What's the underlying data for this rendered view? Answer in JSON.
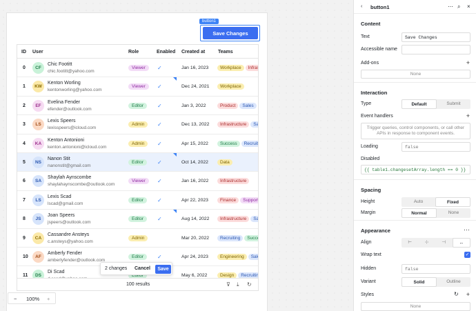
{
  "canvas": {
    "button_tag": "button1",
    "save_changes_label": "Save Changes",
    "table": {
      "headers": {
        "id": "ID",
        "user": "User",
        "role": "Role",
        "enabled": "Enabled",
        "created": "Created at",
        "teams": "Teams"
      },
      "rows": [
        {
          "id": "0",
          "initials": "CF",
          "name": "Chic Footitt",
          "email": "chic.footitt@yahoo.com",
          "role": "Viewer",
          "enabled": true,
          "edited": false,
          "date": "Jan 16, 2023",
          "teams": [
            "Workplace",
            "Infrastructure"
          ],
          "avatar_bg": "#c9f2d9",
          "avatar_fg": "#1f7a47"
        },
        {
          "id": "1",
          "initials": "KW",
          "name": "Kenton Worling",
          "email": "kentonworling@yahoo.com",
          "role": "Viewer",
          "enabled": true,
          "edited": true,
          "date": "Dec 24, 2021",
          "teams": [
            "Workplace"
          ],
          "avatar_bg": "#fbe9a8",
          "avatar_fg": "#8a6b00"
        },
        {
          "id": "2",
          "initials": "EF",
          "name": "Evelina Fender",
          "email": "efender@outlook.com",
          "role": "Editor",
          "enabled": true,
          "edited": false,
          "date": "Jan 3, 2022",
          "teams": [
            "Product",
            "Sales"
          ],
          "avatar_bg": "#f6dbf2",
          "avatar_fg": "#9b2f8c"
        },
        {
          "id": "3",
          "initials": "LS",
          "name": "Lexis Speers",
          "email": "lexisspeers@icloud.com",
          "role": "Admin",
          "enabled": true,
          "edited": false,
          "date": "Dec 13, 2022",
          "teams": [
            "Infrastructure",
            "Sales"
          ],
          "avatar_bg": "#fbd9c4",
          "avatar_fg": "#a04a14"
        },
        {
          "id": "4",
          "initials": "KA",
          "name": "Kenton Antonioni",
          "email": "kenton.antonioni@icloud.com",
          "role": "Admin",
          "enabled": true,
          "edited": false,
          "date": "Apr 15, 2022",
          "teams": [
            "Success",
            "Recruiting"
          ],
          "avatar_bg": "#f6dbf2",
          "avatar_fg": "#9b2f8c"
        },
        {
          "id": "5",
          "initials": "NS",
          "name": "Nanon Stit",
          "email": "nanonstit@gmail.com",
          "role": "Editor",
          "enabled": true,
          "edited": true,
          "date": "Oct 14, 2022",
          "teams": [
            "Data"
          ],
          "avatar_bg": "#d6e4fb",
          "avatar_fg": "#2a56b0",
          "selected": true
        },
        {
          "id": "6",
          "initials": "SA",
          "name": "Shaylah Aynscombe",
          "email": "shaylahaynscombe@outlook.com",
          "role": "Viewer",
          "enabled": true,
          "edited": false,
          "date": "Jan 16, 2022",
          "teams": [
            "Infrastructure"
          ],
          "avatar_bg": "#d6e4fb",
          "avatar_fg": "#2a56b0"
        },
        {
          "id": "7",
          "initials": "LS",
          "name": "Lexis Scad",
          "email": "lscad@gmail.com",
          "role": "Editor",
          "enabled": true,
          "edited": false,
          "date": "Apr 22, 2023",
          "teams": [
            "Finance",
            "Support"
          ],
          "avatar_bg": "#d6e4fb",
          "avatar_fg": "#2a56b0"
        },
        {
          "id": "8",
          "initials": "JS",
          "name": "Joan Speers",
          "email": "jspeers@outlook.com",
          "role": "Editor",
          "enabled": true,
          "edited": true,
          "date": "Aug 14, 2022",
          "teams": [
            "Infrastructure",
            "Sales"
          ],
          "avatar_bg": "#d6e4fb",
          "avatar_fg": "#2a56b0"
        },
        {
          "id": "9",
          "initials": "CA",
          "name": "Cassandre Ansteys",
          "email": "c.ansteys@yahoo.com",
          "role": "Admin",
          "enabled": false,
          "edited": false,
          "date": "Mar 20, 2022",
          "teams": [
            "Recruiting",
            "Success"
          ],
          "avatar_bg": "#fbe9a8",
          "avatar_fg": "#8a6b00"
        },
        {
          "id": "10",
          "initials": "AF",
          "name": "Amberly Fender",
          "email": "amberlyfender@outlook.com",
          "role": "Editor",
          "enabled": true,
          "edited": false,
          "date": "Apr 24, 2023",
          "teams": [
            "Engineering",
            "Sales"
          ],
          "avatar_bg": "#fbd9c4",
          "avatar_fg": "#a04a14"
        },
        {
          "id": "11",
          "initials": "DS",
          "name": "Di Scad",
          "email": "d.scad@yahoo.com",
          "role": "Editor",
          "enabled": false,
          "edited": false,
          "date": "May 6, 2022",
          "teams": [
            "Design",
            "Recruiting"
          ],
          "avatar_bg": "#c9f2d9",
          "avatar_fg": "#1f7a47"
        }
      ],
      "footer_results": "100 results"
    },
    "toast": {
      "changes": "2 changes",
      "cancel": "Cancel",
      "save": "Save"
    },
    "zoom": {
      "minus": "−",
      "value": "100%",
      "plus": "+"
    }
  },
  "role_colors": {
    "Viewer": [
      "#f3dcf7",
      "#8e2ba0"
    ],
    "Editor": [
      "#d2f3df",
      "#1b7a45"
    ],
    "Admin": [
      "#fbeeb0",
      "#7d6300"
    ]
  },
  "team_colors": {
    "Workplace": [
      "#fbeeb0",
      "#7d6300"
    ],
    "Infrastructure": [
      "#fcdcdc",
      "#a82a2a"
    ],
    "Product": [
      "#fcdcdc",
      "#a82a2a"
    ],
    "Sales": [
      "#dbe6fc",
      "#2a56b0"
    ],
    "Success": [
      "#d2f3df",
      "#1b7a45"
    ],
    "Recruiting": [
      "#dbe6fc",
      "#2a56b0"
    ],
    "Data": [
      "#fbeeb0",
      "#7d6300"
    ],
    "Finance": [
      "#fcdcdc",
      "#a82a2a"
    ],
    "Support": [
      "#f3dcf7",
      "#8e2ba0"
    ],
    "Engineering": [
      "#fbeeb0",
      "#7d6300"
    ],
    "Design": [
      "#fbeeb0",
      "#7d6300"
    ]
  },
  "panel": {
    "title": "button1",
    "content": {
      "title": "Content",
      "text_label": "Text",
      "text_value": "Save Changes",
      "accessible_label": "Accessible name",
      "accessible_value": "",
      "addons_label": "Add-ons",
      "addons_none": "None"
    },
    "interaction": {
      "title": "Interaction",
      "type_label": "Type",
      "type_default": "Default",
      "type_submit": "Submit",
      "events_label": "Event handlers",
      "events_hint": "Trigger queries, control components, or call other APIs in response to component events.",
      "loading_label": "Loading",
      "loading_value": "false",
      "disabled_label": "Disabled",
      "disabled_value": "{{ table1.changesetArray.length == 0 }}"
    },
    "spacing": {
      "title": "Spacing",
      "height_label": "Height",
      "height_auto": "Auto",
      "height_fixed": "Fixed",
      "margin_label": "Margin",
      "margin_normal": "Normal",
      "margin_none": "None"
    },
    "appearance": {
      "title": "Appearance",
      "align_label": "Align",
      "wrap_label": "Wrap text",
      "hidden_label": "Hidden",
      "hidden_value": "false",
      "variant_label": "Variant",
      "variant_solid": "Solid",
      "variant_outline": "Outline",
      "styles_label": "Styles",
      "styles_none": "None"
    }
  }
}
